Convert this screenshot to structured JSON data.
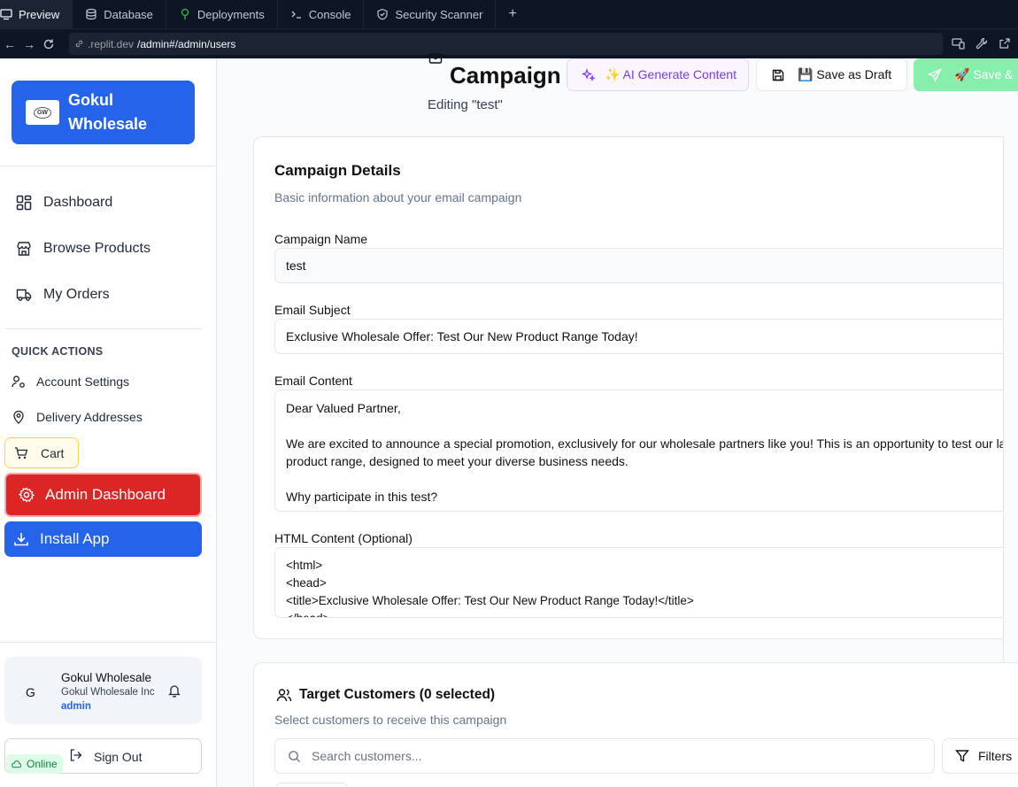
{
  "browser": {
    "tabs": [
      {
        "label": "Preview",
        "icon": "monitor-icon"
      },
      {
        "label": "Database",
        "icon": "database-icon"
      },
      {
        "label": "Deployments",
        "icon": "deploy-icon"
      },
      {
        "label": "Console",
        "icon": "terminal-icon"
      },
      {
        "label": "Security Scanner",
        "icon": "shield-icon"
      }
    ],
    "new_tab": "+",
    "url_host": ".replit.dev",
    "url_path": "/admin#/admin/users"
  },
  "sidebar": {
    "brand": "Gokul Wholesale",
    "brand_logo": "GW",
    "nav": [
      {
        "label": "Dashboard",
        "icon": "grid-icon"
      },
      {
        "label": "Browse Products",
        "icon": "store-icon"
      },
      {
        "label": "My Orders",
        "icon": "truck-icon"
      }
    ],
    "quick_actions_heading": "QUICK ACTIONS",
    "quick_actions": [
      {
        "label": "Account Settings",
        "icon": "user-settings-icon"
      },
      {
        "label": "Delivery Addresses",
        "icon": "map-pin-icon"
      }
    ],
    "cart_label": "Cart",
    "admin_label": "Admin Dashboard",
    "install_label": "Install App",
    "user": {
      "initial": "G",
      "name": "Gokul Wholesale",
      "company": "Gokul Wholesale Inc",
      "role": "admin"
    },
    "signout_label": "Sign Out",
    "online_label": "Online"
  },
  "header": {
    "title": "Campaign",
    "subtitle": "Editing \"test\"",
    "ai_button": "✨ AI Generate Content",
    "draft_button": "💾 Save as Draft",
    "send_button": "🚀 Save &"
  },
  "campaign_details": {
    "title": "Campaign Details",
    "description": "Basic information about your email campaign",
    "name_label": "Campaign Name",
    "name_value": "test",
    "subject_label": "Email Subject",
    "subject_value": "Exclusive Wholesale Offer: Test Our New Product Range Today!",
    "content_label": "Email Content",
    "content_lines": [
      "Dear Valued Partner,",
      "",
      "We are excited to announce a special promotion, exclusively for our wholesale partners like you! This is an opportunity to test our la",
      "product range, designed to meet your diverse business needs.",
      "",
      "Why participate in this test?"
    ],
    "html_label": "HTML Content (Optional)",
    "html_lines": [
      "<html>",
      "<head>",
      "    <title>Exclusive Wholesale Offer: Test Our New Product Range Today!</title>",
      "</head>"
    ]
  },
  "target_customers": {
    "title": "Target Customers (0 selected)",
    "description": "Select customers to receive this campaign",
    "search_placeholder": "Search customers...",
    "filters_label": "Filters"
  },
  "colors": {
    "brand": "#2563eb",
    "admin": "#dc2626",
    "ai": "#7c3aed",
    "send": "#86efac"
  }
}
